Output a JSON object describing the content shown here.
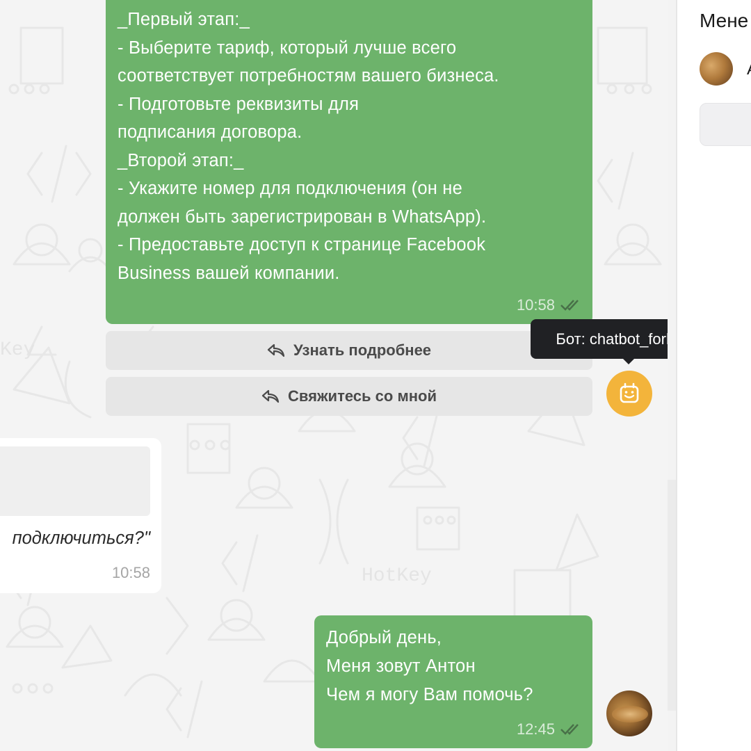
{
  "chat": {
    "message1": {
      "lines": [
        "_Первый этап:_",
        "- Выберите тариф, который лучше всего",
        "соответствует потребностям вашего бизнеса.",
        "- Подготовьте реквизиты для",
        "подписания договора.",
        "_Второй этап:_",
        "- Укажите номер для подключения (он не",
        "должен быть зарегистрирован в WhatsApp).",
        "- Предоставьте доступ к странице Facebook",
        "Business вашей компании."
      ],
      "time": "10:58"
    },
    "buttons": [
      {
        "label": "Узнать подробнее",
        "icon": "reply-icon"
      },
      {
        "label": "Свяжитесь со мной",
        "icon": "reply-icon"
      }
    ],
    "bot_tooltip": "Бот: chatbot_forleads",
    "bot_avatar_icon": "robot-icon",
    "incoming": {
      "text": "подключиться?\"",
      "time": "10:58"
    },
    "message2": {
      "lines": [
        "Добрый день,",
        "Меня зовут Антон",
        "Чем я могу Вам помочь?"
      ],
      "time": "12:45"
    },
    "watermark": "HotKey"
  },
  "right_panel": {
    "title": "Мене",
    "user_initial": "А"
  },
  "colors": {
    "outgoing_bubble": "#6db36b",
    "bot_avatar": "#f3b43b",
    "tooltip_bg": "#202124"
  }
}
